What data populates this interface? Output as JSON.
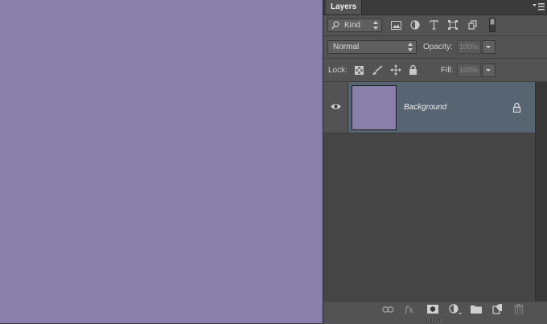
{
  "canvas": {
    "fill_color": "#8880ab"
  },
  "panel": {
    "tab_label": "Layers",
    "menu_icon": "panel-menu-icon"
  },
  "filter": {
    "kind_label": "Kind",
    "icons": [
      "pixel-filter-icon",
      "adjustment-filter-icon",
      "type-filter-icon",
      "shape-filter-icon",
      "smart-object-filter-icon",
      "filter-toggle-switch"
    ]
  },
  "blend": {
    "mode": "Normal",
    "opacity_label": "Opacity:",
    "opacity_value": "100%"
  },
  "lock": {
    "label": "Lock:",
    "icons": [
      "lock-transparent-pixels-icon",
      "lock-image-pixels-icon",
      "lock-position-icon",
      "lock-all-icon"
    ],
    "fill_label": "Fill:",
    "fill_value": "100%"
  },
  "layers": [
    {
      "name": "Background",
      "visible": true,
      "locked": true,
      "thumb_color": "#8880ab",
      "selected": true
    }
  ],
  "footer_icons": [
    "link-layers-icon",
    "fx-icon",
    "add-mask-icon",
    "adjustment-layer-icon",
    "new-group-icon",
    "new-layer-icon",
    "trash-icon"
  ],
  "colors": {
    "panel_bg": "#535353",
    "selected_row": "#576472",
    "list_bg": "#454545"
  }
}
